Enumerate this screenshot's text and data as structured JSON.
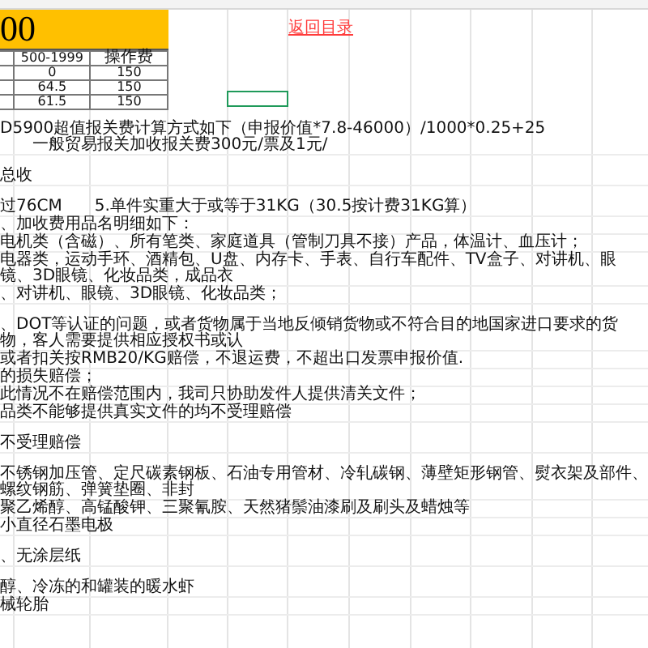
{
  "banner": {
    "text": "00"
  },
  "price_table": {
    "columns": [
      "500-1999",
      "操作费"
    ],
    "rows": [
      [
        "0",
        "150"
      ],
      [
        "64.5",
        "150"
      ],
      [
        "61.5",
        "150"
      ]
    ]
  },
  "back_link": "返回目录",
  "cursor_cell": {
    "selected": true
  },
  "notes": [
    {
      "lines": [
        [
          "D5900超值报关费计算方式如下（申报价值*7.8-46000）/1000*0.25+25",
          "一般贸易报关加收报关费300元/票及1元/"
        ]
      ]
    },
    {
      "lines": [
        [
          "总收"
        ]
      ]
    },
    {
      "lines": [
        [
          "过76CM",
          "5.单件实重大于或等于31KG（30.5按计费31KG算）"
        ],
        [
          "、加收费用品名明细如下："
        ],
        [
          "电机类（含磁）、所有笔类、家庭道具（管制刀具不接）产品，体温计、血压计；"
        ],
        [
          "电器类，运动手环、酒精包、U盘、内存卡、手表、自行车配件、TV盒子、对讲机、眼镜、3D眼镜、化妆品类，成品衣"
        ],
        [
          "、对讲机、眼镜、3D眼镜、化妆品类；"
        ]
      ]
    },
    {
      "lines": [
        [
          "、DOT等认证的问题，或者货物属于当地反倾销货物或不符合目的地国家进口要求的货物，客人需要提供相应授权书或认"
        ],
        [
          "或者扣关按RMB20/KG赔偿，不退运费，不超出口发票申报价值."
        ],
        [
          "的损失赔偿；"
        ],
        [
          "此情况不在赔偿范围内，我司只协助发件人提供清关文件；"
        ],
        [
          "品类不能够提供真实文件的均不受理赔偿"
        ]
      ]
    },
    {
      "lines": [
        [
          "不受理赔偿"
        ]
      ]
    },
    {
      "lines": [
        [
          "不锈钢加压管、定尺碳素钢板、石油专用管材、冷轧碳钢、薄壁矩形钢管、熨衣架及部件、螺纹钢筋、弹簧垫圈、非封"
        ],
        [
          "聚乙烯醇、高锰酸钾、三聚氰胺、天然猪鬃油漆刷及刷头及蜡烛等"
        ],
        [
          "小直径石墨电极"
        ]
      ]
    },
    {
      "lines": [
        [
          "、无涂层纸"
        ]
      ]
    },
    {
      "lines": [
        [
          "醇、冷冻的和罐装的暖水虾"
        ],
        [
          "械轮胎"
        ]
      ]
    }
  ]
}
